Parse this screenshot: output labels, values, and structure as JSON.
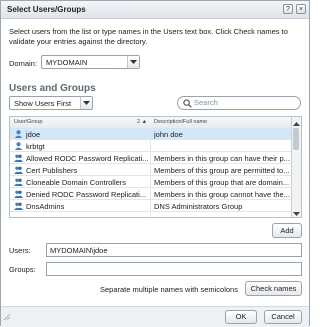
{
  "dialog": {
    "title": "Select Users/Groups",
    "help_label": "?",
    "close_label": "×"
  },
  "intro_text": "Select users from the list or type names in the Users text box. Click Check names to validate your entries against the directory.",
  "domain": {
    "label": "Domain:",
    "value": "MYDOMAIN"
  },
  "section_title": "Users and Groups",
  "filter": {
    "value": "Show Users First"
  },
  "search": {
    "placeholder": "Search"
  },
  "table": {
    "columns": [
      "User/Group",
      "Description/Full name"
    ],
    "sort_indicator": "2 ▲",
    "rows": [
      {
        "name": "jdoe",
        "description": "john doe",
        "type": "user",
        "selected": true
      },
      {
        "name": "krbtgt",
        "description": "",
        "type": "user",
        "selected": false
      },
      {
        "name": "Allowed RODC Password Replicati...",
        "description": "Members in this group can have their p...",
        "type": "group",
        "selected": false
      },
      {
        "name": "Cert Publishers",
        "description": "Members of this group are permitted to...",
        "type": "group",
        "selected": false
      },
      {
        "name": "Cloneable Domain Controllers",
        "description": "Members of this group that are domain...",
        "type": "group",
        "selected": false
      },
      {
        "name": "Denied RODC Password Replicati...",
        "description": "Members in this group cannot have the...",
        "type": "group",
        "selected": false
      },
      {
        "name": "DnsAdmins",
        "description": "DNS Administrators Group",
        "type": "group",
        "selected": false
      }
    ]
  },
  "add_button": "Add",
  "users_field": {
    "label": "Users:",
    "value": "MYDOMAIN\\jdoe"
  },
  "groups_field": {
    "label": "Groups:",
    "value": ""
  },
  "separator_hint": "Separate multiple names with semicolons",
  "check_names_button": "Check names",
  "ok_button": "OK",
  "cancel_button": "Cancel",
  "colors": {
    "selection": "#d3e7f8",
    "section_title": "#5e6a73",
    "user_icon": "#3b82c4"
  }
}
